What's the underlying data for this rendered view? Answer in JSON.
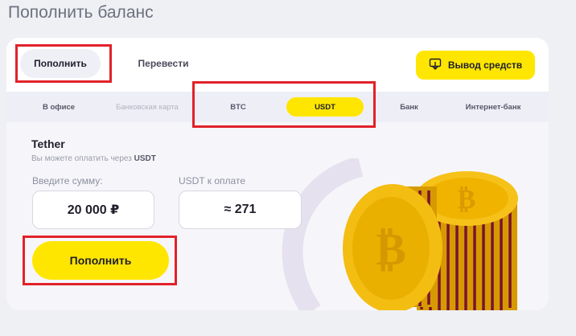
{
  "page": {
    "title": "Пополнить баланс"
  },
  "tabs": {
    "deposit": "Пополнить",
    "transfer": "Перевести"
  },
  "withdraw": {
    "label": "Вывод средств",
    "icon": "withdraw-icon"
  },
  "methods": [
    {
      "label": "В офисе",
      "state": "normal"
    },
    {
      "label": "Банковская карта",
      "state": "disabled"
    },
    {
      "label": "BTC",
      "state": "normal"
    },
    {
      "label": "USDT",
      "state": "selected"
    },
    {
      "label": "Банк",
      "state": "normal"
    },
    {
      "label": "Интернет-банк",
      "state": "normal"
    }
  ],
  "form": {
    "coin": "Tether",
    "subtitle_prefix": "Вы можете оплатить через",
    "subtitle_coin": "USDT",
    "amount_label": "Введите сумму:",
    "amount_value": "20 000 ₽",
    "pay_label": "USDT к оплате",
    "pay_value": "≈ 271",
    "submit": "Пополнить"
  },
  "colors": {
    "accent": "#ffe600",
    "highlight": "#e1222a",
    "coin": "#f2b705"
  }
}
